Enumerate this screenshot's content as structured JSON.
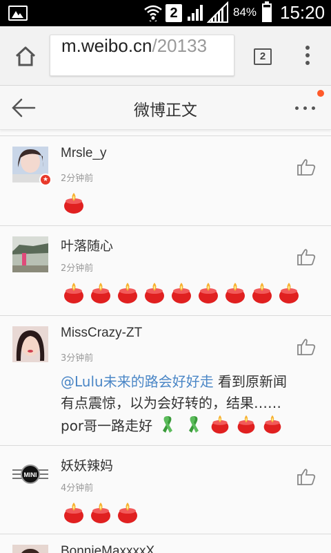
{
  "status_bar": {
    "sim_slot": "2",
    "battery_percent": "84%",
    "battery_level": 0.84,
    "time": "15:20"
  },
  "browser": {
    "url_host": "m.weibo.cn",
    "url_path": "/20133",
    "tab_count": "2"
  },
  "header": {
    "title": "微博正文",
    "has_notification_dot": true
  },
  "colors": {
    "mention": "#4a86c6",
    "notification_dot": "#ff5a2a",
    "candle_red": "#e02020",
    "ribbon_green": "#3a9a3a"
  },
  "comments": [
    {
      "username": "Mrsle_y",
      "time": "2分钟前",
      "verified_badge": true,
      "emojis": [
        "candle-icon"
      ]
    },
    {
      "username": "叶落随心",
      "time": "2分钟前",
      "verified_badge": false,
      "emojis": [
        "candle-icon",
        "candle-icon",
        "candle-icon",
        "candle-icon",
        "candle-icon",
        "candle-icon",
        "candle-icon",
        "candle-icon",
        "candle-icon"
      ]
    },
    {
      "username": "MissCrazy-ZT",
      "time": "3分钟前",
      "verified_badge": false,
      "mention": "@Lulu未来的路会好好走",
      "text_line1": " 看到原新闻",
      "text_line2": "有点震惊，以为会好转的，结果……",
      "text_line3": "por哥一路走好",
      "emojis": [
        "green-ribbon-icon",
        "green-ribbon-icon",
        "candle-icon",
        "candle-icon",
        "candle-icon"
      ]
    },
    {
      "username": "妖妖辣妈",
      "time": "4分钟前",
      "verified_badge": false,
      "avatar_text": "MINI",
      "emojis": [
        "candle-icon",
        "candle-icon",
        "candle-icon"
      ]
    },
    {
      "username": "BonnieMaxxxxX"
    }
  ]
}
